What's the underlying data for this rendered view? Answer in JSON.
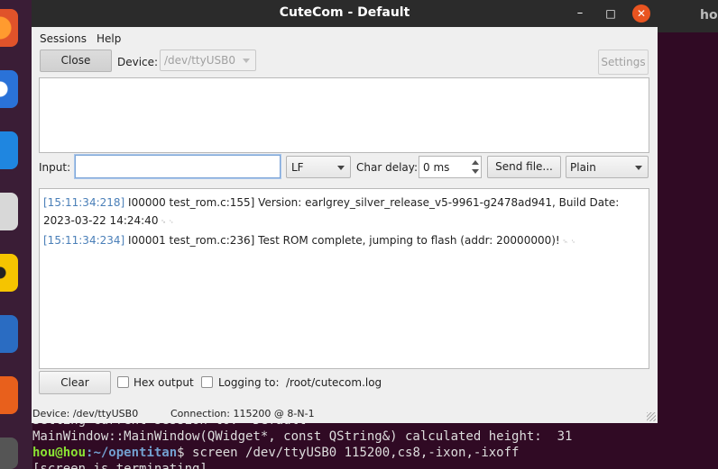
{
  "window": {
    "title": "CuteCom - Default"
  },
  "titlebar": {
    "minimize": "–",
    "maximize": "□",
    "close": "✕"
  },
  "menu": {
    "sessions": "Sessions",
    "help": "Help"
  },
  "toolbar": {
    "close_label": "Close",
    "device_label": "Device:",
    "device_value": "/dev/ttyUSB0",
    "settings_label": "Settings"
  },
  "input_row": {
    "input_label": "Input:",
    "input_value": "",
    "line_end": "LF",
    "char_delay_label": "Char delay:",
    "char_delay_value": "0 ms",
    "send_file_label": "Send file...",
    "format": "Plain"
  },
  "output": {
    "lines": [
      {
        "timestamp": "[15:11:34:218]",
        "text": " I00000 test_rom.c:155] Version: earlgrey_silver_release_v5-9961-g2478ad941, Build Date: 2023-03-22 14:24:40",
        "ctrl": " ␍ ␊"
      },
      {
        "timestamp": "[15:11:34:234]",
        "text": " I00001 test_rom.c:236] Test ROM complete, jumping to flash (addr: 20000000)!",
        "ctrl": " ␍ ␊"
      }
    ]
  },
  "bottom_row": {
    "clear_label": "Clear",
    "hex_output_label": "Hex output",
    "logging_label": "Logging to:",
    "log_path": "/root/cutecom.log"
  },
  "statusbar": {
    "device": "Device:  /dev/ttyUSB0",
    "connection": "Connection:  115200 @ 8-N-1"
  },
  "terminal": {
    "title": "ho",
    "lines": [
      {
        "text": "Setting current session to: 'Default'"
      },
      {
        "text": "MainWindow::MainWindow(QWidget*, const QString&) calculated height:  31"
      },
      {
        "user": "hou@hou",
        "path": ":~/opentitan",
        "cmd": "$ screen /dev/ttyUSB0 115200,cs8,-ixon,-ixoff"
      },
      {
        "text": "[screen is terminating]"
      }
    ]
  },
  "colors": {
    "accent_close": "#e95420",
    "timestamp": "#4a7fb8",
    "terminal_bg": "#300a24"
  }
}
